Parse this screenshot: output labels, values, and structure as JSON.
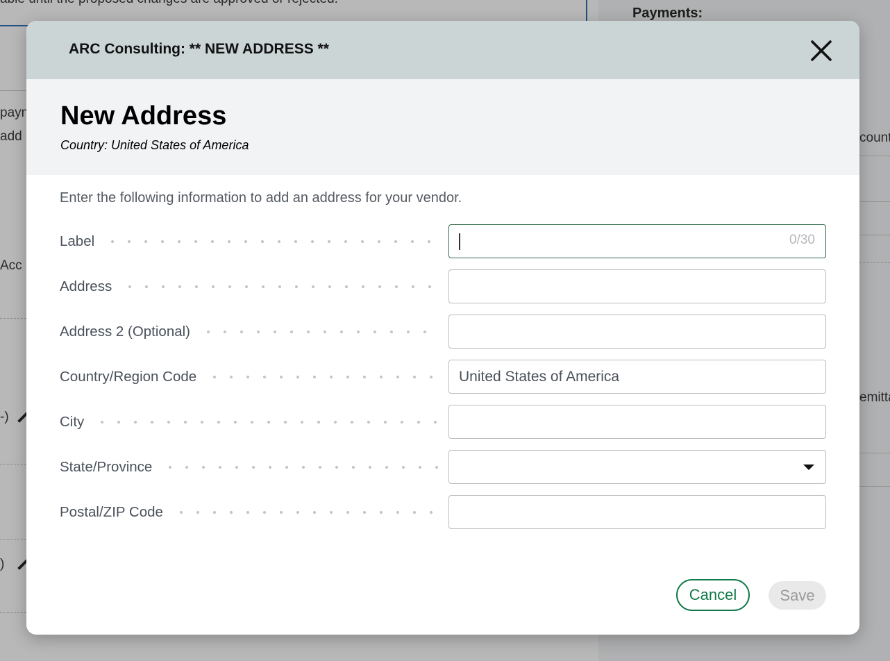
{
  "background": {
    "banner_text": "able until the proposed changes are approved or rejected.",
    "left_fragments": [
      "payn",
      "add n",
      "Acc",
      "-)",
      ")"
    ],
    "right_heading": "Payments:",
    "right_fragments": [
      "count",
      "emitta"
    ]
  },
  "modal": {
    "header_title": "ARC Consulting: ** NEW ADDRESS **",
    "title": "New Address",
    "country_line": "Country: United States of America",
    "intro": "Enter the following information to add an address for your vendor.",
    "fields": {
      "label": {
        "label": "Label",
        "value": "",
        "counter": "0/30"
      },
      "address": {
        "label": "Address",
        "value": ""
      },
      "address2": {
        "label": "Address 2 (Optional)",
        "value": ""
      },
      "country": {
        "label": "Country/Region Code",
        "value": "United States of America"
      },
      "city": {
        "label": "City",
        "value": ""
      },
      "state": {
        "label": "State/Province",
        "value": ""
      },
      "postal": {
        "label": "Postal/ZIP Code",
        "value": ""
      }
    },
    "buttons": {
      "cancel": "Cancel",
      "save": "Save"
    }
  },
  "icons": {
    "close": "close-icon",
    "dropdown": "chevron-down-icon"
  },
  "colors": {
    "primary": "#127a4a",
    "header_bg": "#cbd5d5",
    "subheader_bg": "#f1f3f5",
    "link_blue": "#2a6bb5"
  }
}
